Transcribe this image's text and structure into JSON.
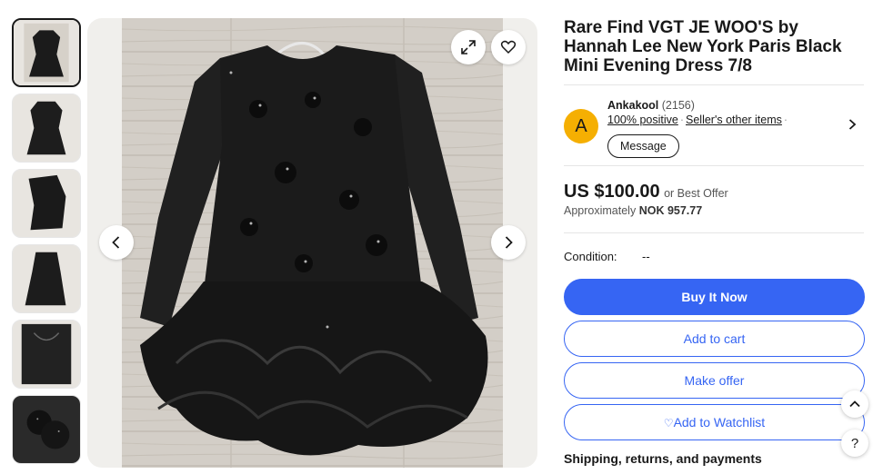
{
  "listing": {
    "title": "Rare Find VGT JE WOO'S by Hannah Lee New York Paris Black Mini Evening Dress 7/8"
  },
  "seller": {
    "avatar_letter": "A",
    "name": "Ankakool",
    "count": "(2156)",
    "positive": "100% positive",
    "other_items": "Seller's other items",
    "message_label": "Message"
  },
  "price": {
    "amount": "US $100.00",
    "offer_note": "or Best Offer",
    "approx_label": "Approximately",
    "approx_value": "NOK 957.77"
  },
  "condition": {
    "label": "Condition:",
    "value": "--"
  },
  "actions": {
    "buy_now": "Buy It Now",
    "add_to_cart": "Add to cart",
    "make_offer": "Make offer",
    "watchlist": "Add to Watchlist"
  },
  "shipping_heading": "Shipping, returns, and payments",
  "floating": {
    "help": "?"
  },
  "gallery": {
    "thumbnail_count": 6,
    "selected_index": 0
  },
  "colors": {
    "primary_blue": "#3665f3",
    "avatar_yellow": "#f5af02",
    "dress": "#1b1b1b",
    "floor": "#cfcac3"
  },
  "icons": [
    "expand-icon",
    "heart-icon",
    "chevron-left-icon",
    "chevron-right-icon",
    "chevron-up-icon",
    "help-icon"
  ]
}
